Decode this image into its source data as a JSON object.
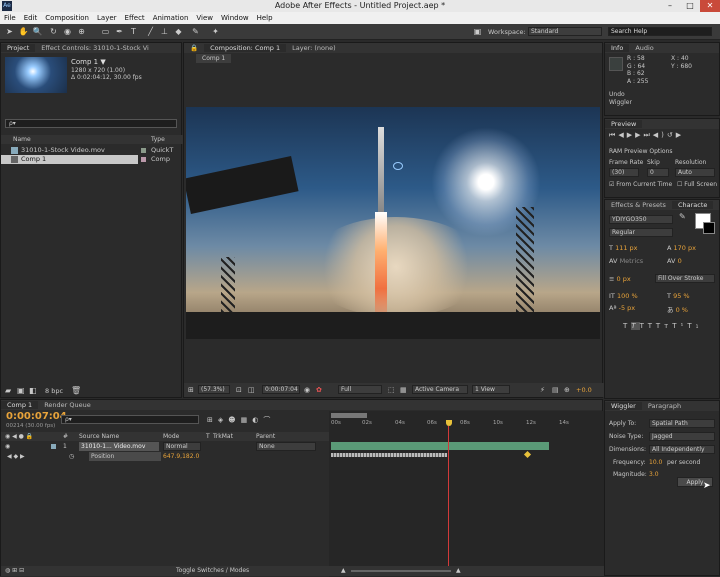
{
  "app": {
    "title": "Adobe After Effects - Untitled Project.aep *",
    "logo": "Ae"
  },
  "menu": [
    "File",
    "Edit",
    "Composition",
    "Layer",
    "Effect",
    "Animation",
    "View",
    "Window",
    "Help"
  ],
  "toolbar": {
    "workspace_label": "Workspace:",
    "workspace_value": "Standard",
    "search_placeholder": "Search Help"
  },
  "project": {
    "tab": "Project",
    "tab2": "Effect Controls: 31010-1-Stock Vi",
    "comp_name": "Comp 1 ▼",
    "comp_size": "1280 x 720 (1.00)",
    "comp_duration": "Δ 0:02:04:12, 30.00 fps",
    "search_placeholder": "ρ▾",
    "col_name": "Name",
    "col_type": "Type",
    "items": [
      {
        "name": "31010-1-Stock Video.mov",
        "type": "QuickT"
      },
      {
        "name": "Comp 1",
        "type": "Comp"
      }
    ],
    "bpc": "8 bpc"
  },
  "composition": {
    "tab": "Composition: Comp 1",
    "layer_tab": "Layer: (none)",
    "sub_tab": "Comp 1",
    "zoom": "(57.3%)",
    "timecode": "0:00:07:04",
    "resolution": "Full",
    "camera": "Active Camera",
    "view": "1 View",
    "exposure": "+0.0"
  },
  "info": {
    "tab": "Info",
    "tab2": "Audio",
    "r": "R : 58",
    "g": "G : 64",
    "b": "B : 62",
    "a": "A : 255",
    "x": "X : 40",
    "y": "Y : 680",
    "undo": "Undo",
    "undo_action": "Wiggler"
  },
  "preview": {
    "tab": "Preview",
    "ram_options": "RAM Preview Options",
    "frame_rate_label": "Frame Rate",
    "skip_label": "Skip",
    "resolution_label": "Resolution",
    "frame_rate": "(30)",
    "skip": "0",
    "resolution": "Auto",
    "from_current": "From Current Time",
    "full_screen": "Full Screen"
  },
  "character": {
    "tab": "Effects & Presets",
    "tab2": "Characte",
    "font": "YDIYGO350",
    "style": "Regular",
    "size": "111 px",
    "leading": "170 px",
    "metrics": "Metrics",
    "tracking": "0",
    "stroke_width": "0 px",
    "stroke_type": "Fill Over Stroke",
    "vscale": "100 %",
    "hscale": "95 %",
    "baseline": "-5 px",
    "tsume": "0 %"
  },
  "wiggler": {
    "tab": "Wiggler",
    "tab2": "Paragraph",
    "apply_to_label": "Apply To:",
    "apply_to": "Spatial Path",
    "noise_label": "Noise Type:",
    "noise": "Jagged",
    "dims_label": "Dimensions:",
    "dims": "All Independently",
    "freq_label": "Frequency:",
    "freq": "10.0",
    "freq_unit": "per second",
    "mag_label": "Magnitude:",
    "mag": "3.0",
    "apply_button": "Apply"
  },
  "timeline": {
    "tab": "Comp 1",
    "tab2": "Render Queue",
    "timecode": "0:00:07:04",
    "frame_info": "00214 (30.00 fps)",
    "search_placeholder": "ρ▾",
    "col_num": "#",
    "col_source": "Source Name",
    "col_mode": "Mode",
    "col_t": "T",
    "col_trkmat": "TrkMat",
    "col_parent": "Parent",
    "layer_num": "1",
    "layer_name": "31010-1... Video.mov",
    "layer_mode": "Normal",
    "layer_parent": "None",
    "prop_name": "Position",
    "prop_value": "647.9,182.0",
    "ruler": [
      "00s",
      "02s",
      "04s",
      "06s",
      "08s",
      "10s",
      "12s",
      "14s"
    ],
    "toggle": "Toggle Switches / Modes"
  },
  "colors": {
    "accent": "#e8a33a",
    "layer_bar": "#5a9a77",
    "cti": "#d23a3a"
  }
}
